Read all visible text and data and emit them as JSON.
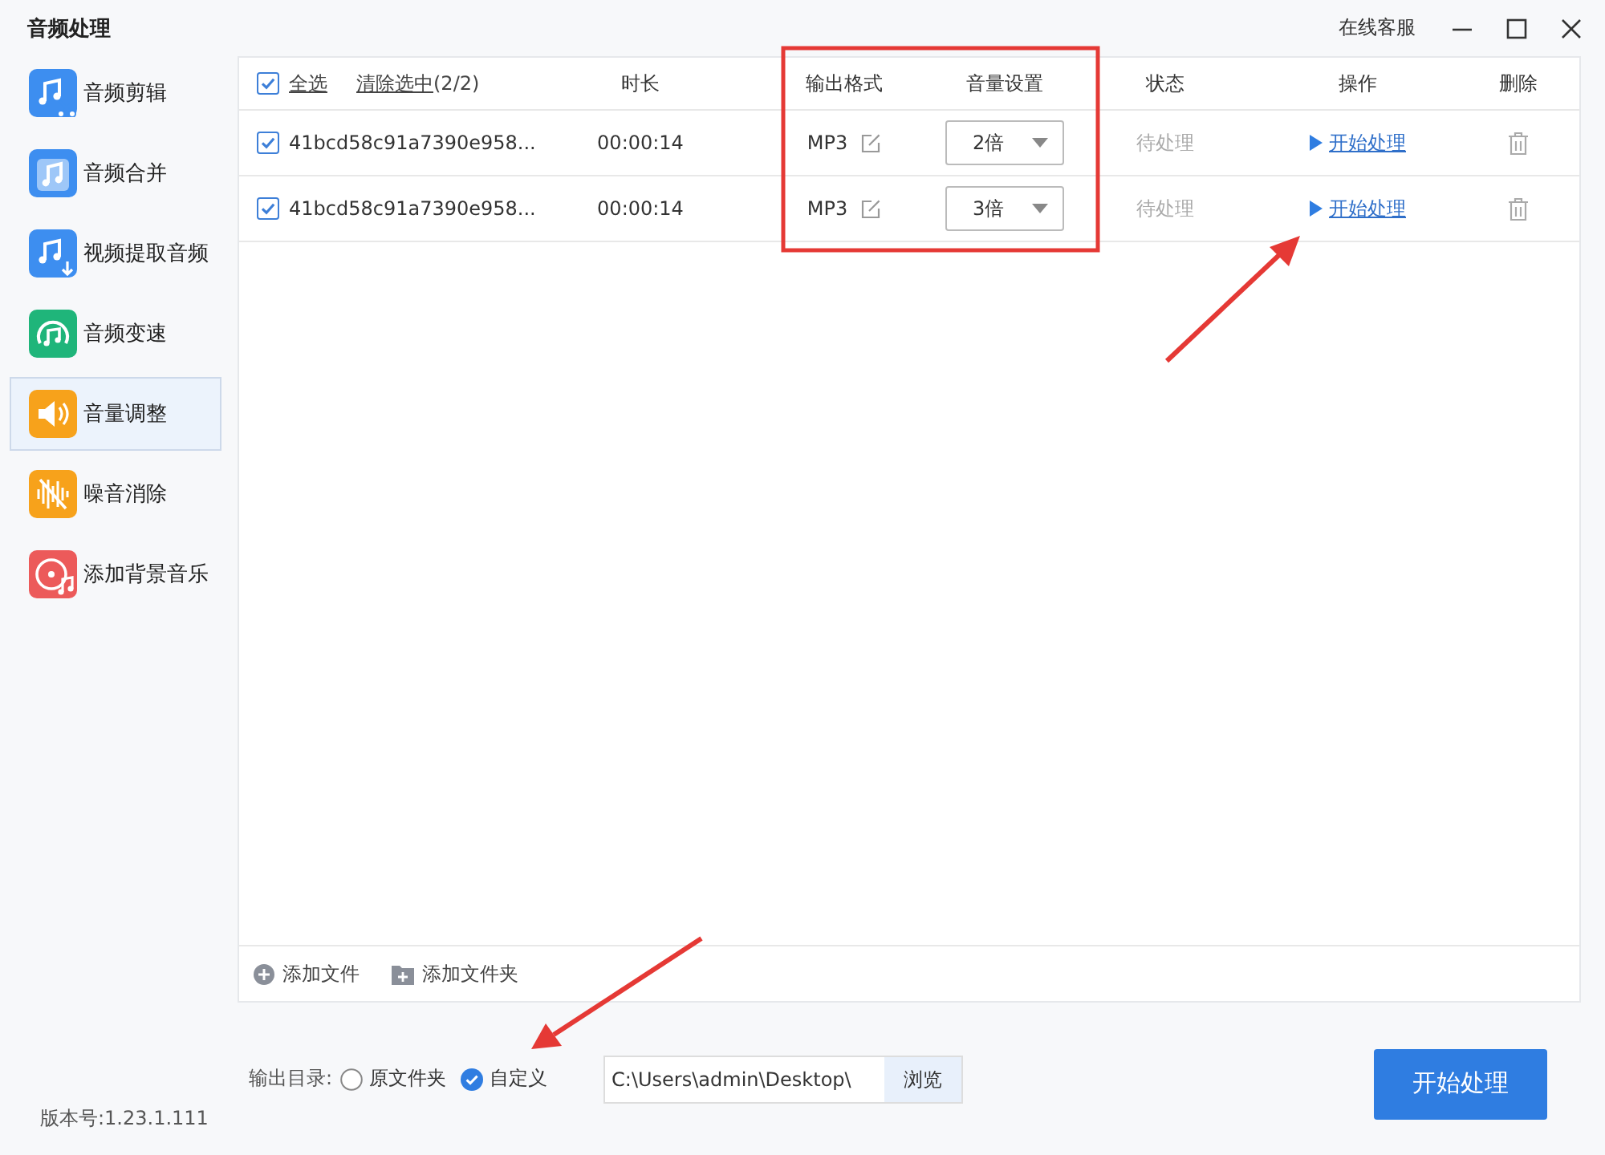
{
  "window": {
    "title": "音频处理",
    "support": "在线客服"
  },
  "sidebar": {
    "items": [
      {
        "label": "音频剪辑",
        "kind": "cut",
        "color": "#3d8ef0",
        "selected": false
      },
      {
        "label": "音频合并",
        "kind": "merge",
        "color": "#3d8ef0",
        "selected": false
      },
      {
        "label": "视频提取音频",
        "kind": "extract",
        "color": "#3d8ef0",
        "selected": false
      },
      {
        "label": "音频变速",
        "kind": "speed",
        "color": "#1fb57a",
        "selected": false
      },
      {
        "label": "音量调整",
        "kind": "volume",
        "color": "#f7a21b",
        "selected": true
      },
      {
        "label": "噪音消除",
        "kind": "noise",
        "color": "#f7a21b",
        "selected": false
      },
      {
        "label": "添加背景音乐",
        "kind": "music",
        "color": "#ec5a5a",
        "selected": false
      }
    ]
  },
  "table": {
    "select_all": {
      "label": "全选",
      "checked": true
    },
    "clear": {
      "label": "清除选中",
      "count": "(2/2)"
    },
    "columns": [
      "时长",
      "输出格式",
      "音量设置",
      "状态",
      "操作",
      "删除"
    ],
    "rows": [
      {
        "checked": true,
        "name": "41bcd58c91a7390e958...",
        "duration": "00:00:14",
        "format": "MP3",
        "volume": "2倍",
        "status": "待处理",
        "action": "开始处理"
      },
      {
        "checked": true,
        "name": "41bcd58c91a7390e958...",
        "duration": "00:00:14",
        "format": "MP3",
        "volume": "3倍",
        "status": "待处理",
        "action": "开始处理"
      }
    ],
    "add_actions": [
      {
        "label": "添加文件",
        "kind": "file"
      },
      {
        "label": "添加文件夹",
        "kind": "folder"
      }
    ]
  },
  "output": {
    "label": "输出目录:",
    "options": [
      {
        "label": "原文件夹",
        "selected": false
      },
      {
        "label": "自定义",
        "selected": true
      }
    ],
    "path": "C:\\Users\\admin\\Desktop\\",
    "browse": "浏览"
  },
  "start_button": "开始处理",
  "version": "版本号:1.23.1.111"
}
